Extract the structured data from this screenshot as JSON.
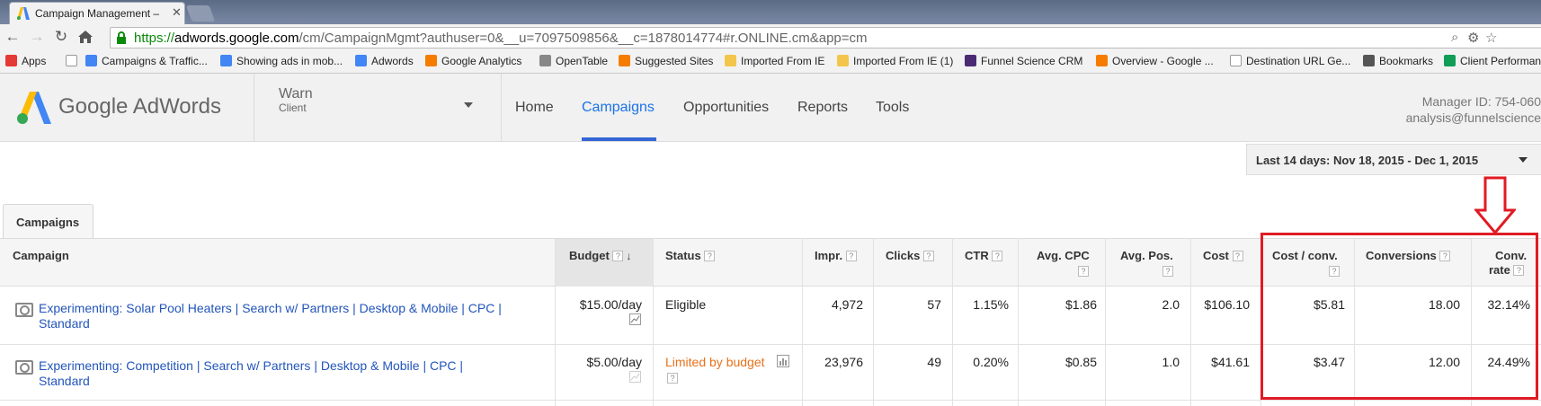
{
  "browser": {
    "tab_title": "Campaign Management –",
    "tab_close": "✕",
    "url_scheme": "https://",
    "url_host": "adwords.google.com",
    "url_path": "/cm/CampaignMgmt?authuser=0&__u=7097509856&__c=1878014774#r.ONLINE.cm&app=cm",
    "bookmarks": [
      {
        "label": "Apps",
        "icon": "apps-grid-icon",
        "color": "#e53935"
      },
      {
        "label": "",
        "icon": "page-icon",
        "color": "#ffffff"
      },
      {
        "label": "Campaigns & Traffic...",
        "icon": "google-icon",
        "color": "#4285f4"
      },
      {
        "label": "Showing ads in mob...",
        "icon": "google-g-icon",
        "color": "#4285f4"
      },
      {
        "label": "Adwords",
        "icon": "google-g-icon",
        "color": "#4285f4"
      },
      {
        "label": "Google Analytics",
        "icon": "analytics-icon",
        "color": "#f57c00"
      },
      {
        "label": "OpenTable",
        "icon": "opentable-icon",
        "color": "#888888"
      },
      {
        "label": "Suggested Sites",
        "icon": "suggested-sites-icon",
        "color": "#f57c00"
      },
      {
        "label": "Imported From IE",
        "icon": "folder-icon",
        "color": "#f3c64b"
      },
      {
        "label": "Imported From IE (1)",
        "icon": "folder-icon",
        "color": "#f3c64b"
      },
      {
        "label": "Funnel Science CRM",
        "icon": "b-icon",
        "color": "#4b2a74"
      },
      {
        "label": "Overview - Google ...",
        "icon": "analytics-icon",
        "color": "#f57c00"
      },
      {
        "label": "Destination URL Ge...",
        "icon": "page-icon",
        "color": "#ffffff"
      },
      {
        "label": "Bookmarks",
        "icon": "star-icon",
        "color": "#555555"
      },
      {
        "label": "Client Performan",
        "icon": "sheets-icon",
        "color": "#0f9d58"
      }
    ]
  },
  "header": {
    "logo_text": "Google AdWords",
    "account_name": "Warn",
    "account_type": "Client",
    "nav": [
      "Home",
      "Campaigns",
      "Opportunities",
      "Reports",
      "Tools"
    ],
    "active_nav": "Campaigns",
    "manager_id": "Manager ID: 754-060",
    "email": "analysis@funnelscience"
  },
  "date_range": {
    "label": "Last 14 days: Nov 18, 2015 - Dec 1, 2015"
  },
  "tabs": {
    "campaigns": "Campaigns"
  },
  "table": {
    "columns": {
      "campaign": "Campaign",
      "budget": "Budget",
      "status": "Status",
      "impr": "Impr.",
      "clicks": "Clicks",
      "ctr": "CTR",
      "avg_cpc_1": "Avg. CPC",
      "avg_pos": "Avg. Pos.",
      "cost": "Cost",
      "cost_conv": "Cost / conv.",
      "conversions": "Conversions",
      "conv_rate_1": "Conv.",
      "conv_rate_2": "rate"
    },
    "help_glyph": "?",
    "sort_glyph": "↓",
    "rows": [
      {
        "campaign_line1": "Experimenting: Solar Pool Heaters | Search w/ Partners | Desktop & Mobile | CPC |",
        "campaign_line2": "Standard",
        "budget": "$15.00/day",
        "status": "Eligible",
        "impr": "4,972",
        "clicks": "57",
        "ctr": "1.15%",
        "avg_cpc": "$1.86",
        "avg_pos": "2.0",
        "cost": "$106.10",
        "cost_conv": "$5.81",
        "conversions": "18.00",
        "conv_rate": "32.14%"
      },
      {
        "campaign_line1": "Experimenting: Competition | Search w/ Partners | Desktop & Mobile | CPC |",
        "campaign_line2": "Standard",
        "budget": "$5.00/day",
        "status": "Limited by budget",
        "impr": "23,976",
        "clicks": "49",
        "ctr": "0.20%",
        "avg_cpc": "$0.85",
        "avg_pos": "1.0",
        "cost": "$41.61",
        "cost_conv": "$3.47",
        "conversions": "12.00",
        "conv_rate": "24.49%"
      }
    ]
  },
  "colors": {
    "accent_blue": "#3367d6",
    "link_blue": "#2255bb",
    "status_limited": "#e8711a",
    "annotation_red": "#e01b24"
  }
}
